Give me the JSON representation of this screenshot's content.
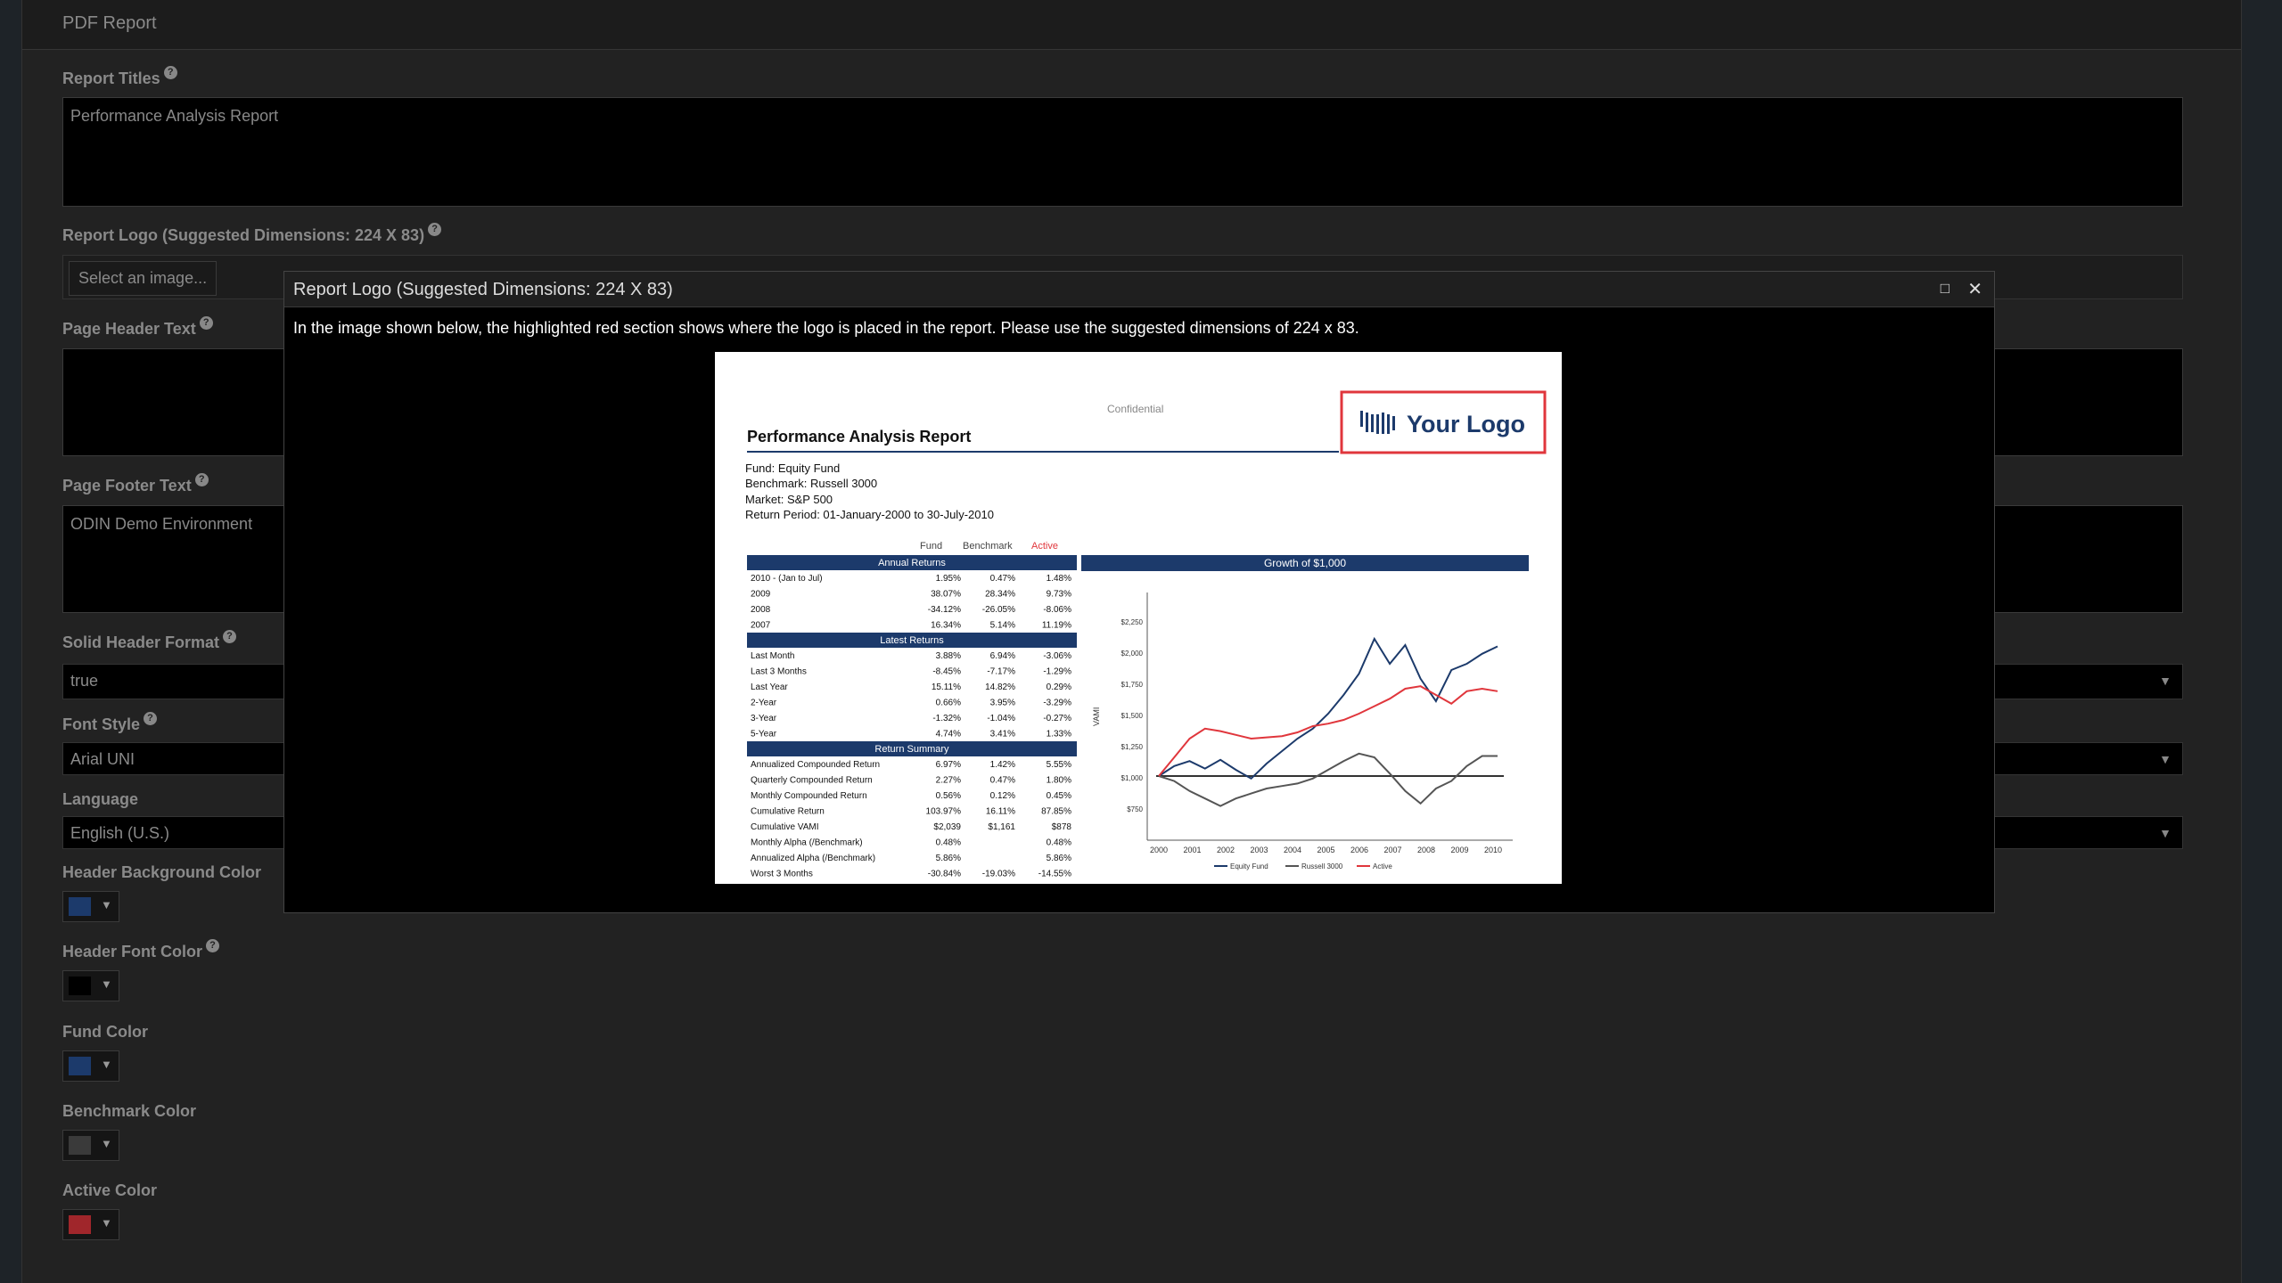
{
  "panel": {
    "title": "PDF Report"
  },
  "fields": {
    "report_titles": {
      "label": "Report Titles",
      "value": "Performance Analysis Report"
    },
    "report_logo": {
      "label": "Report Logo (Suggested Dimensions: 224 X 83)",
      "button": "Select an image..."
    },
    "page_header": {
      "label": "Page Header Text",
      "value": ""
    },
    "page_footer": {
      "label": "Page Footer Text",
      "value": "ODIN Demo Environment"
    },
    "solid_header": {
      "label": "Solid Header Format",
      "value": "true"
    },
    "font_style": {
      "label": "Font Style",
      "value": "Arial UNI"
    },
    "language": {
      "label": "Language",
      "value": "English (U.S.)"
    },
    "header_bg_color": {
      "label": "Header Background Color",
      "color": "#1c3a6b"
    },
    "header_font_color": {
      "label": "Header Font Color",
      "color": "#000000"
    },
    "fund_color": {
      "label": "Fund Color",
      "color": "#1c3a6b"
    },
    "benchmark_color": {
      "label": "Benchmark Color",
      "color": "#3a3a3a"
    },
    "active_color": {
      "label": "Active Color",
      "color": "#a0262b"
    }
  },
  "icons": {
    "help": "question-circle-icon",
    "arrow": "▼",
    "maximize": "□",
    "close": "✕"
  },
  "dialog": {
    "title": "Report Logo (Suggested Dimensions: 224 X 83)",
    "description": "In the image shown below, the highlighted red section shows where the logo is placed in the report. Please use the suggested dimensions of 224 x 83.",
    "preview": {
      "confidential": "Confidential",
      "report_title": "Performance Analysis Report",
      "logo_text": "Your Logo",
      "fund_line": "Fund: Equity Fund",
      "benchmark_line": "Benchmark: Russell 3000",
      "market_line": "Market: S&P 500",
      "period_line": "Return Period: 01-January-2000 to 30-July-2010",
      "col_fund": "Fund",
      "col_benchmark": "Benchmark",
      "col_active": "Active",
      "annual_header": "Annual Returns",
      "annual_rows": [
        [
          "2010 - (Jan to Jul)",
          "1.95%",
          "0.47%",
          "1.48%"
        ],
        [
          "2009",
          "38.07%",
          "28.34%",
          "9.73%"
        ],
        [
          "2008",
          "-34.12%",
          "-26.05%",
          "-8.06%"
        ],
        [
          "2007",
          "16.34%",
          "5.14%",
          "11.19%"
        ]
      ],
      "latest_header": "Latest Returns",
      "latest_rows": [
        [
          "Last Month",
          "3.88%",
          "6.94%",
          "-3.06%"
        ],
        [
          "Last 3 Months",
          "-8.45%",
          "-7.17%",
          "-1.29%"
        ],
        [
          "Last Year",
          "15.11%",
          "14.82%",
          "0.29%"
        ],
        [
          "2-Year",
          "0.66%",
          "3.95%",
          "-3.29%"
        ],
        [
          "3-Year",
          "-1.32%",
          "-1.04%",
          "-0.27%"
        ],
        [
          "5-Year",
          "4.74%",
          "3.41%",
          "1.33%"
        ]
      ],
      "summary_header": "Return Summary",
      "summary_rows": [
        [
          "Annualized Compounded Return",
          "6.97%",
          "1.42%",
          "5.55%"
        ],
        [
          "Quarterly Compounded Return",
          "2.27%",
          "0.47%",
          "1.80%"
        ],
        [
          "Monthly Compounded Return",
          "0.56%",
          "0.12%",
          "0.45%"
        ],
        [
          "Cumulative Return",
          "103.97%",
          "16.11%",
          "87.85%"
        ],
        [
          "Cumulative VAMI",
          "$2,039",
          "$1,161",
          "$878"
        ],
        [
          "Monthly Alpha (/Benchmark)",
          "0.48%",
          "",
          "0.48%"
        ],
        [
          "Annualized Alpha (/Benchmark)",
          "5.86%",
          "",
          "5.86%"
        ],
        [
          "Worst 3 Months",
          "-30.84%",
          "-19.03%",
          "-14.55%"
        ]
      ],
      "growth_header": "Growth of $1,000",
      "y_label": "VAMI",
      "y_ticks": [
        "$2,250",
        "$2,000",
        "$1,750",
        "$1,500",
        "$1,250",
        "$1,000",
        "$750"
      ],
      "x_ticks": [
        "2000",
        "2001",
        "2002",
        "2003",
        "2004",
        "2005",
        "2006",
        "2007",
        "2008",
        "2009",
        "2010"
      ],
      "legend": [
        "Equity Fund",
        "Russell 3000",
        "Active"
      ]
    }
  }
}
